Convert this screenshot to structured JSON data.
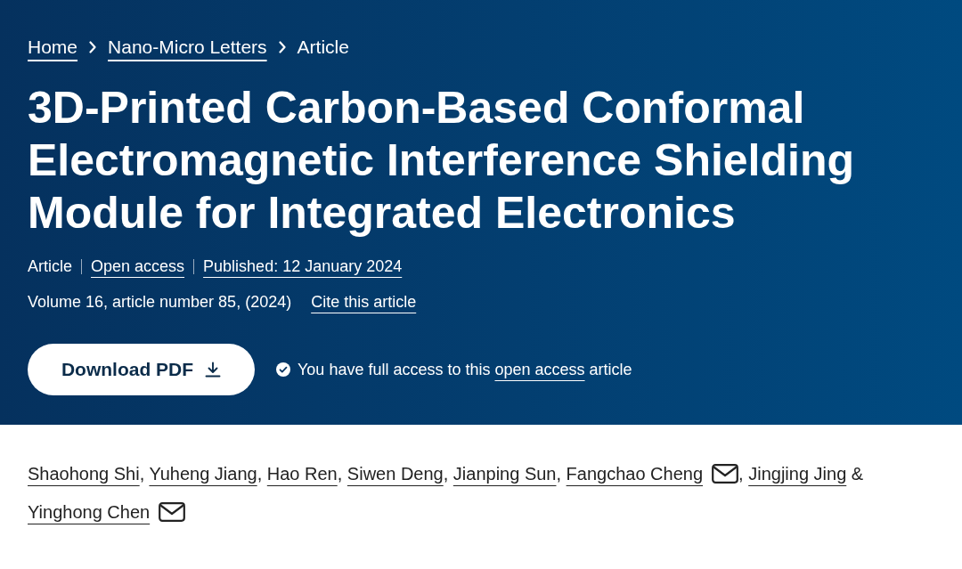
{
  "breadcrumbs": [
    {
      "label": "Home",
      "link": true
    },
    {
      "label": "Nano-Micro Letters",
      "link": true
    },
    {
      "label": "Article",
      "link": false
    }
  ],
  "title": "3D-Printed Carbon-Based Conformal Electromagnetic Interference Shielding Module for Integrated Electronics",
  "meta": [
    {
      "label": "Article",
      "link": false
    },
    {
      "label": "Open access",
      "link": true
    },
    {
      "label": "Published: 12 January 2024",
      "link": true
    }
  ],
  "citation": {
    "text": "Volume 16, article number 85, (2024)",
    "cite_link": "Cite this article"
  },
  "download_button": {
    "label": "Download PDF"
  },
  "access_note": {
    "before": "You have full access to this",
    "link": "open access",
    "after": "article"
  },
  "authors": [
    {
      "name": "Shaohong Shi",
      "email": false,
      "separator": ","
    },
    {
      "name": "Yuheng Jiang",
      "email": false,
      "separator": ","
    },
    {
      "name": "Hao Ren",
      "email": false,
      "separator": ","
    },
    {
      "name": "Siwen Deng",
      "email": false,
      "separator": ","
    },
    {
      "name": "Jianping Sun",
      "email": false,
      "separator": ","
    },
    {
      "name": "Fangchao Cheng",
      "email": true,
      "separator": ","
    },
    {
      "name": "Jingjing Jing",
      "email": false,
      "separator": "&"
    },
    {
      "name": "Yinghong Chen",
      "email": true
    }
  ]
}
